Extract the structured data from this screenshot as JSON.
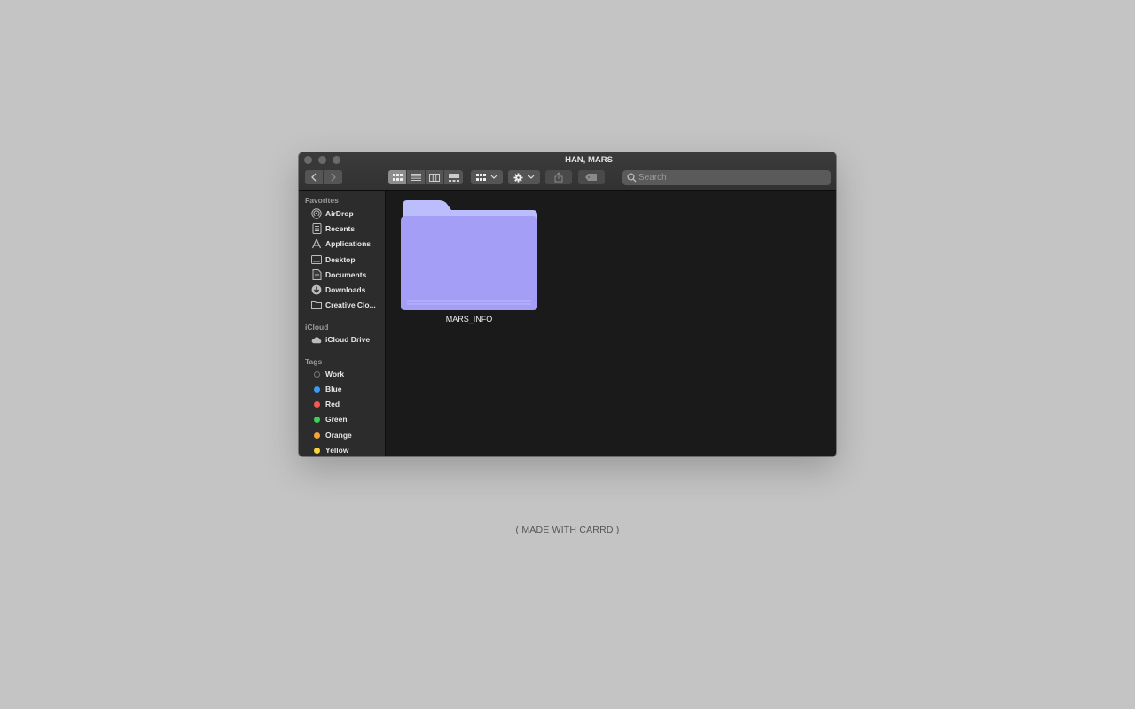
{
  "window": {
    "title": "HAN, MARS"
  },
  "toolbar": {
    "search_placeholder": "Search"
  },
  "sidebar": {
    "favorites_label": "Favorites",
    "favorites": [
      {
        "label": "AirDrop",
        "icon": "airdrop-icon"
      },
      {
        "label": "Recents",
        "icon": "recents-icon"
      },
      {
        "label": "Applications",
        "icon": "applications-icon"
      },
      {
        "label": "Desktop",
        "icon": "desktop-icon"
      },
      {
        "label": "Documents",
        "icon": "documents-icon"
      },
      {
        "label": "Downloads",
        "icon": "downloads-icon"
      },
      {
        "label": "Creative Clo...",
        "icon": "folder-icon"
      }
    ],
    "icloud_label": "iCloud",
    "icloud": [
      {
        "label": "iCloud Drive",
        "icon": "cloud-icon"
      }
    ],
    "tags_label": "Tags",
    "tags": [
      {
        "label": "Work",
        "color": "#2c2c2c"
      },
      {
        "label": "Blue",
        "color": "#3b9af5"
      },
      {
        "label": "Red",
        "color": "#f5584f"
      },
      {
        "label": "Green",
        "color": "#37d356"
      },
      {
        "label": "Orange",
        "color": "#f7a339"
      },
      {
        "label": "Yellow",
        "color": "#f9d439"
      }
    ]
  },
  "content": {
    "items": [
      {
        "name": "MARS_INFO",
        "type": "folder",
        "color": "#a49ef6"
      }
    ]
  },
  "footer": {
    "text": "( MADE WITH CARRD )"
  }
}
